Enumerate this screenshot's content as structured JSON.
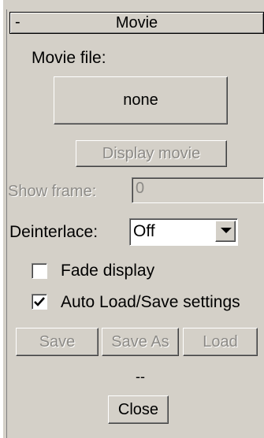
{
  "rollout": {
    "collapse_sign": "-",
    "title": "Movie"
  },
  "movie_file": {
    "label": "Movie file:",
    "button_label": "none"
  },
  "display_movie": {
    "label": "Display movie",
    "enabled": false
  },
  "show_frame": {
    "label": "Show frame:",
    "value": "0",
    "enabled": false
  },
  "deinterlace": {
    "label": "Deinterlace:",
    "selected": "Off"
  },
  "fade_display": {
    "label": "Fade display",
    "checked": false
  },
  "auto_load_save": {
    "label": "Auto Load/Save settings",
    "checked": true
  },
  "settings_buttons": {
    "save": "Save",
    "save_as": "Save As",
    "load": "Load"
  },
  "status_text": "--",
  "close_label": "Close",
  "colors": {
    "panel_bg": "#d4d0c8",
    "disabled_text": "#8c8a86",
    "shadow": "#808080",
    "highlight": "#ffffff"
  }
}
